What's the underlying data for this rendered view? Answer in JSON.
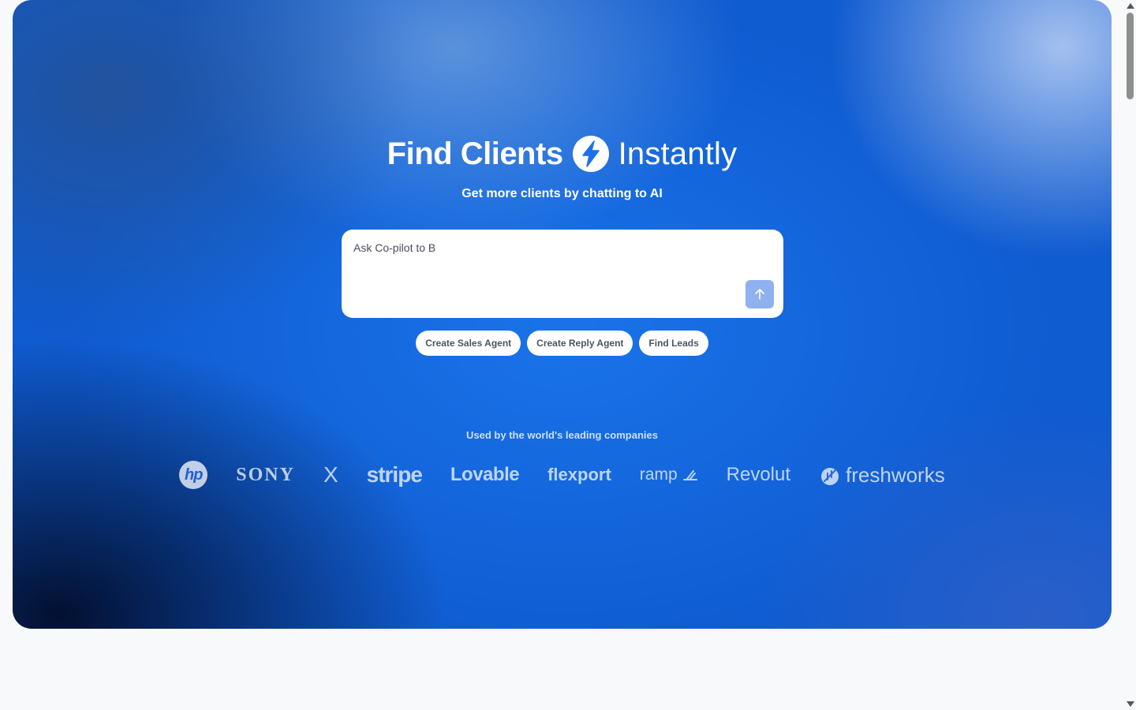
{
  "hero": {
    "title_part1": "Find Clients",
    "title_icon": "lightning-bolt-icon",
    "title_part2": "Instantly",
    "subtitle": "Get more clients by chatting to AI"
  },
  "prompt": {
    "value": "Ask Co-pilot to B",
    "placeholder": "Ask Co-pilot to B",
    "send_icon": "arrow-up-icon"
  },
  "chips": [
    {
      "label": "Create Sales Agent"
    },
    {
      "label": "Create Reply Agent"
    },
    {
      "label": "Find Leads"
    }
  ],
  "companies": {
    "heading": "Used by the world's leading companies",
    "logos": [
      {
        "name": "hp",
        "text": "hp"
      },
      {
        "name": "sony",
        "text": "SONY"
      },
      {
        "name": "x",
        "text": "X"
      },
      {
        "name": "stripe",
        "text": "stripe"
      },
      {
        "name": "lovable",
        "text": "Lovable"
      },
      {
        "name": "flexport",
        "text": "flexport"
      },
      {
        "name": "ramp",
        "text": "ramp"
      },
      {
        "name": "revolut",
        "text": "Revolut"
      },
      {
        "name": "freshworks",
        "text": "freshworks"
      }
    ]
  },
  "colors": {
    "hero_blue": "#1a73ea",
    "send_button": "#8fb1ee",
    "page_background": "#f8f9fa",
    "chip_text": "#4b5563"
  }
}
